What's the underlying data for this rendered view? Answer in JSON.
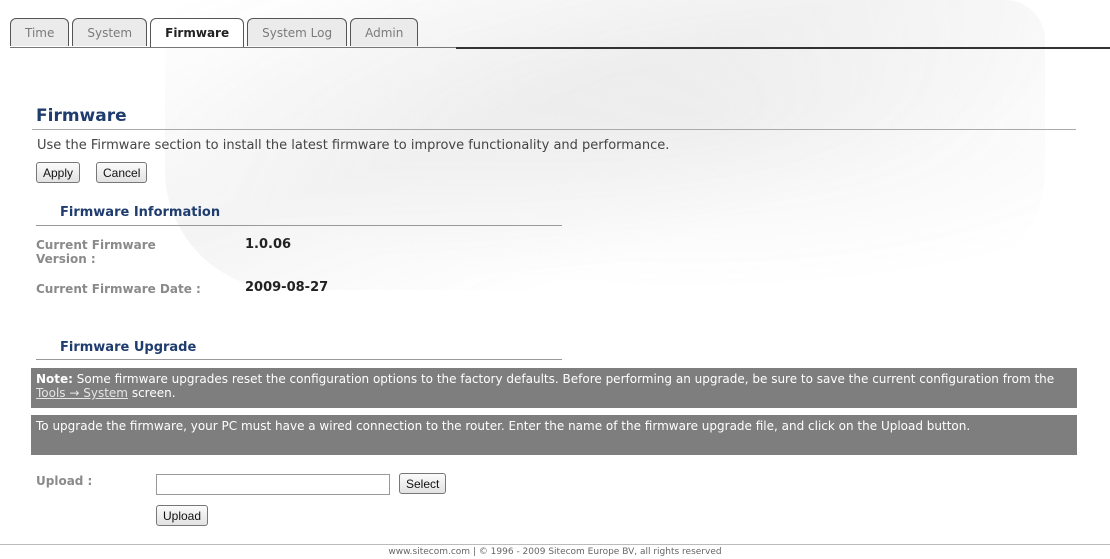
{
  "tabs": [
    {
      "label": "Time",
      "active": false
    },
    {
      "label": "System",
      "active": false
    },
    {
      "label": "Firmware",
      "active": true
    },
    {
      "label": "System Log",
      "active": false
    },
    {
      "label": "Admin",
      "active": false
    }
  ],
  "page": {
    "title": "Firmware",
    "intro": "Use the Firmware section to install the latest firmware to improve functionality and performance."
  },
  "buttons": {
    "apply": "Apply",
    "cancel": "Cancel",
    "select": "Select",
    "upload": "Upload"
  },
  "firmware_info": {
    "heading": "Firmware Information",
    "version_label_line1": "Current Firmware",
    "version_label_line2": "Version :",
    "version_value": "1.0.06",
    "date_label": "Current Firmware Date :",
    "date_value": "2009-08-27"
  },
  "firmware_upgrade": {
    "heading": "Firmware Upgrade",
    "note_prefix": "Note:",
    "note_text": " Some firmware upgrades reset the configuration options to the factory defaults. Before performing an upgrade, be sure to save the current configuration from the ",
    "note_link": "Tools → System",
    "note_suffix": " screen.",
    "instructions": "To upgrade the firmware, your PC must have a wired connection to the router. Enter the name of the firmware upgrade file, and click on the Upload button.",
    "upload_label": "Upload :",
    "upload_value": ""
  },
  "footer": "www.sitecom.com | © 1996 - 2009 Sitecom Europe BV, all rights reserved",
  "colors": {
    "title": "#1f3c6e",
    "band": "#7e7e7e"
  }
}
